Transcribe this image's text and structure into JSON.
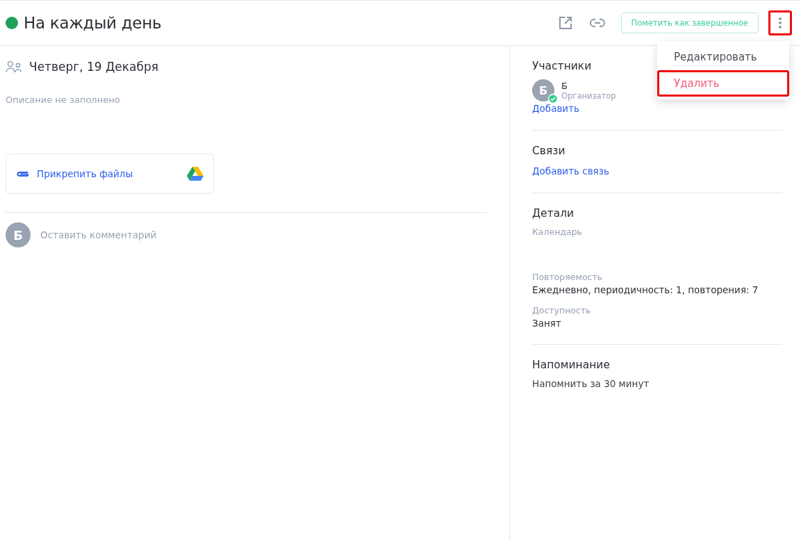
{
  "header": {
    "color": "#21a05a",
    "title": "На каждый день",
    "complete_button": "Пометить как завершенное",
    "more_button": {
      "highlighted": true
    }
  },
  "menu": {
    "items": [
      {
        "label": "Редактировать",
        "kind": "normal",
        "highlighted": false
      },
      {
        "label": "Удалить",
        "kind": "danger",
        "highlighted": true
      }
    ]
  },
  "event": {
    "date": "Четверг, 19 Декабря",
    "description": "Описание не заполнено",
    "attach_label": "Прикрепить файлы",
    "comment": {
      "avatar_letter": "Б",
      "placeholder": "Оставить комментарий"
    }
  },
  "sidebar": {
    "participants": {
      "title": "Участники",
      "people": [
        {
          "initial": "Б",
          "name": "Б",
          "role": "Организатор",
          "confirmed": true
        }
      ],
      "add_link": "Добавить"
    },
    "links": {
      "title": "Связи",
      "add_link": "Добавить связь"
    },
    "details": {
      "title": "Детали",
      "fields": [
        {
          "label": "Календарь"
        },
        {
          "label": "Повторяемость",
          "value": "Ежедневно, периодичность: 1, повторения: 7"
        },
        {
          "label": "Доступность",
          "value": "Занят"
        }
      ]
    },
    "reminder": {
      "title": "Напоминание",
      "text": "Напомнить за 30 минут"
    }
  }
}
